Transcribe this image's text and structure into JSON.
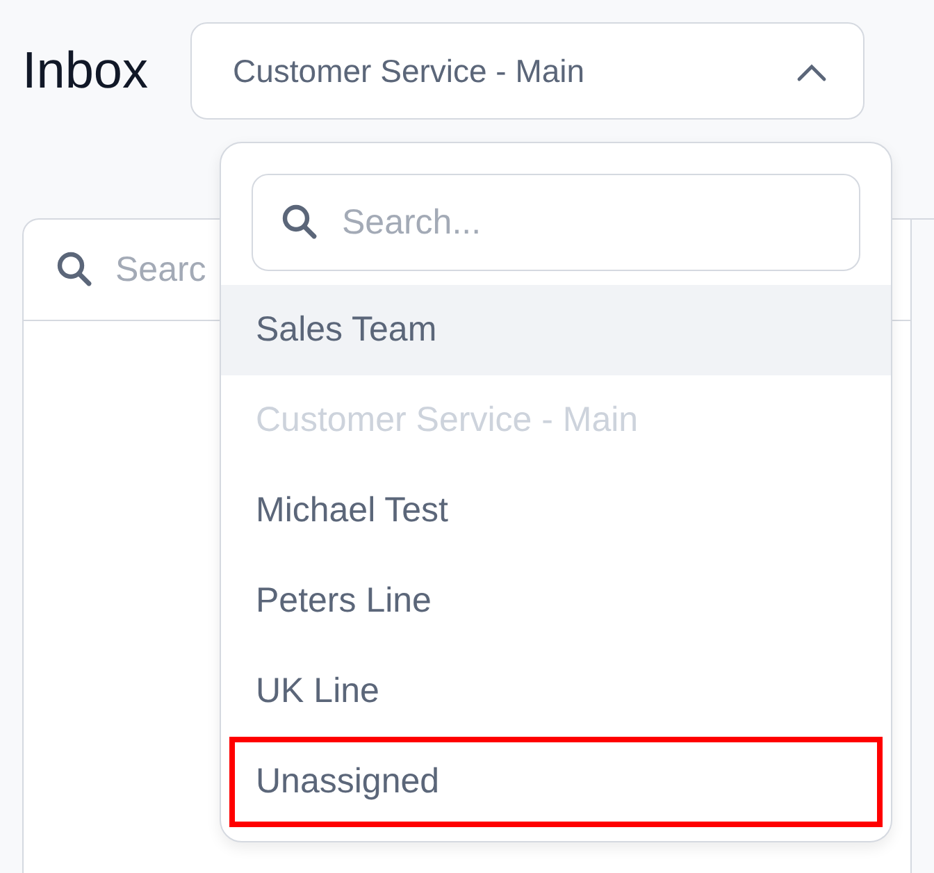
{
  "title": "Inbox",
  "inbox_select": {
    "value": "Customer Service - Main",
    "expanded": true
  },
  "list_panel": {
    "search": {
      "placeholder": "Searc"
    }
  },
  "dropdown": {
    "search": {
      "placeholder": "Search..."
    },
    "items": [
      {
        "label": "Sales Team",
        "hovered": true,
        "disabled": false,
        "highlighted": false
      },
      {
        "label": "Customer Service - Main",
        "hovered": false,
        "disabled": true,
        "highlighted": false
      },
      {
        "label": "Michael Test",
        "hovered": false,
        "disabled": false,
        "highlighted": false
      },
      {
        "label": "Peters Line",
        "hovered": false,
        "disabled": false,
        "highlighted": false
      },
      {
        "label": "UK Line",
        "hovered": false,
        "disabled": false,
        "highlighted": false
      },
      {
        "label": "Unassigned",
        "hovered": false,
        "disabled": false,
        "highlighted": true
      }
    ]
  }
}
